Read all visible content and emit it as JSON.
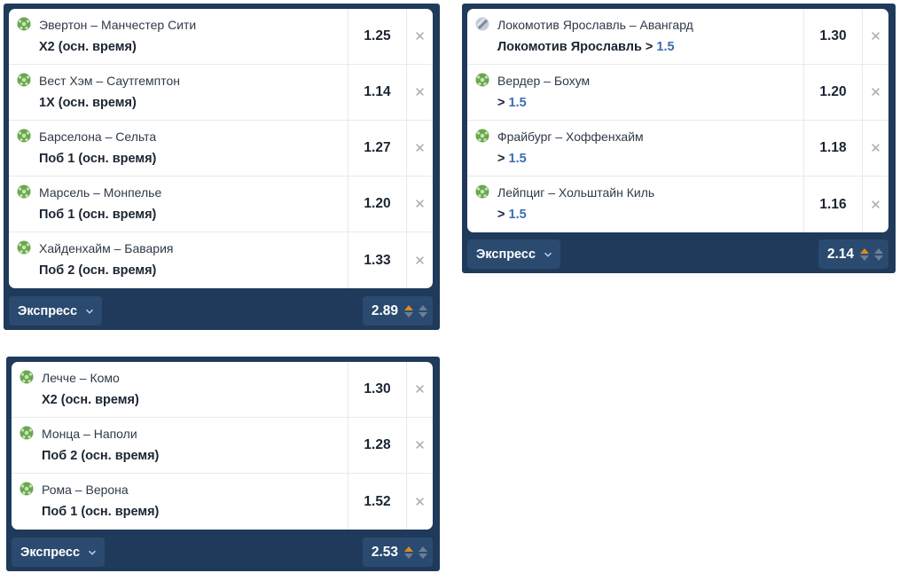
{
  "colors": {
    "panel_bg": "#1f3a5b",
    "footer_btn_bg": "#2b4a6f",
    "card_bg": "#ffffff",
    "bet_value_blue": "#3a6fb0",
    "odds_up_orange": "#e08a1e",
    "football_green": "#6aa84f"
  },
  "slips": [
    {
      "type_label": "Экспресс",
      "total_odds": "2.89",
      "bets": [
        {
          "sport_icon": "football-icon",
          "match": "Эвертон – Манчестер Сити",
          "bet": "Х2 (осн. время)",
          "value": "",
          "odds": "1.25"
        },
        {
          "sport_icon": "football-icon",
          "match": "Вест Хэм – Саутгемптон",
          "bet": "1Х (осн. время)",
          "value": "",
          "odds": "1.14"
        },
        {
          "sport_icon": "football-icon",
          "match": "Барселона – Сельта",
          "bet": "Поб 1 (осн. время)",
          "value": "",
          "odds": "1.27"
        },
        {
          "sport_icon": "football-icon",
          "match": "Марсель – Монпелье",
          "bet": "Поб 1 (осн. время)",
          "value": "",
          "odds": "1.20"
        },
        {
          "sport_icon": "football-icon",
          "match": "Хайденхайм – Бавария",
          "bet": "Поб 2 (осн. время)",
          "value": "",
          "odds": "1.33"
        }
      ]
    },
    {
      "type_label": "Экспресс",
      "total_odds": "2.14",
      "bets": [
        {
          "sport_icon": "hockey-puck-icon",
          "match": "Локомотив Ярославль – Авангард",
          "bet": "Локомотив Ярославль >",
          "value": "1.5",
          "odds": "1.30"
        },
        {
          "sport_icon": "football-icon",
          "match": "Вердер – Бохум",
          "bet": ">",
          "value": "1.5",
          "odds": "1.20"
        },
        {
          "sport_icon": "football-icon",
          "match": "Фрайбург – Хоффенхайм",
          "bet": ">",
          "value": "1.5",
          "odds": "1.18"
        },
        {
          "sport_icon": "football-icon",
          "match": "Лейпциг – Хольштайн Киль",
          "bet": ">",
          "value": "1.5",
          "odds": "1.16"
        }
      ]
    },
    {
      "type_label": "Экспресс",
      "total_odds": "2.53",
      "bets": [
        {
          "sport_icon": "football-icon",
          "match": "Лечче – Комо",
          "bet": "Х2 (осн. время)",
          "value": "",
          "odds": "1.30"
        },
        {
          "sport_icon": "football-icon",
          "match": "Монца – Наполи",
          "bet": "Поб 2 (осн. время)",
          "value": "",
          "odds": "1.28"
        },
        {
          "sport_icon": "football-icon",
          "match": "Рома – Верона",
          "bet": "Поб 1 (осн. время)",
          "value": "",
          "odds": "1.52"
        }
      ]
    }
  ],
  "remove_glyph": "✕"
}
